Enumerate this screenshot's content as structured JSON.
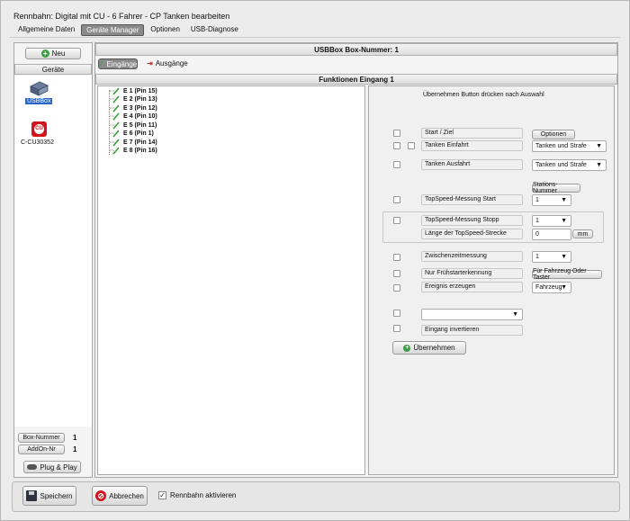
{
  "window": {
    "title": "Rennbahn: Digital mit CU - 6 Fahrer - CP Tanken bearbeiten"
  },
  "menu": [
    {
      "label": "Allgemeine Daten",
      "active": false
    },
    {
      "label": "Geräte Manager",
      "active": true
    },
    {
      "label": "Optionen",
      "active": false
    },
    {
      "label": "USB-Diagnose",
      "active": false
    }
  ],
  "sidebar": {
    "new_button": "Neu",
    "devices_header": "Geräte",
    "devices": [
      {
        "label": "USBBox",
        "icon": "usbbox-icon",
        "selected": true
      },
      {
        "label": "C-CU30352",
        "icon": "cu-device-icon",
        "selected": false
      }
    ],
    "box_number_label": "Box-Nummer",
    "box_number_value": "1",
    "addon_label": "AddOn-Nr",
    "addon_value": "1",
    "plug_play_button": "Plug & Play"
  },
  "main": {
    "header": "USBBox  Box-Nummer: 1",
    "tabs": [
      {
        "label": "Eingänge",
        "active": true
      },
      {
        "label": "Ausgänge",
        "active": false
      }
    ],
    "functions_header": "Funktionen Eingang 1",
    "inputs": [
      "E 1 (Pin 15)",
      "E 2 (Pin 13)",
      "E 3 (Pin 12)",
      "E 4 (Pin 10)",
      "E 5 (Pin 11)",
      "E 6 (Pin 1)",
      "E 7 (Pin 14)",
      "E 8 (Pin 16)"
    ],
    "hint": "Übernehmen Button drücken nach Auswahl",
    "options_button": "Optionen",
    "start_ziel": "Start / Ziel",
    "tanken_einfahrt": "Tanken Einfahrt",
    "tanken_einfahrt_select": "Tanken und Strafe",
    "tanken_ausfahrt": "Tanken Ausfahrt",
    "tanken_ausfahrt_select": "Tanken und Strafe",
    "stations_nummer_button": "Stations-Nummer",
    "topspeed_start": "TopSpeed-Messung Start",
    "topspeed_start_select": "1",
    "topspeed_stopp": "TopSpeed-Messung Stopp",
    "topspeed_stopp_select": "1",
    "topspeed_laenge": "Länge der TopSpeed-Strecke",
    "topspeed_laenge_value": "0",
    "topspeed_unit": "mm",
    "zwischenzeit": "Zwischenzeitmessung",
    "zwischenzeit_select": "1",
    "fruehstarter": "Nur Frühstarterkennung",
    "fruehstarter_button": "Für Fahrzeug Oder Taster",
    "ereignis": "Ereignis erzeugen",
    "ereignis_select": "Fahrzeug",
    "custom_select": "",
    "invertieren": "Eingang invertieren",
    "apply_button": "Übernehmen"
  },
  "footer": {
    "save_button": "Speichern",
    "cancel_button": "Abbrechen",
    "activate_label": "Rennbahn aktivieren",
    "activate_checked": true
  }
}
